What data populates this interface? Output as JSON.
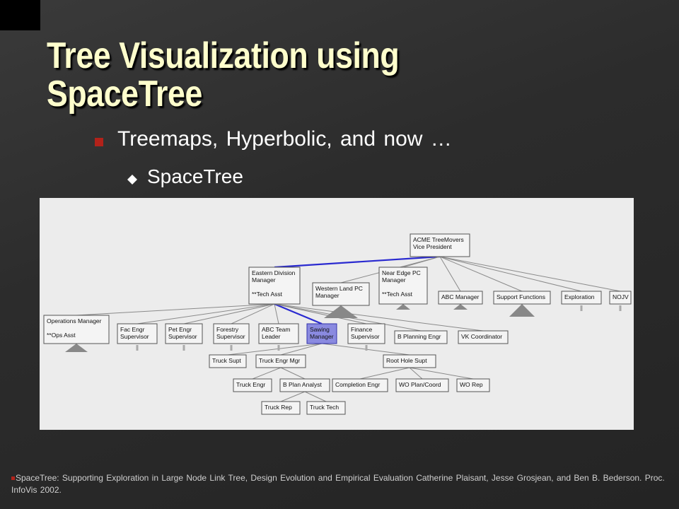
{
  "slide": {
    "title_line1": "Tree Visualization using",
    "title_line2": "SpaceTree",
    "bullet1": "Treemaps, Hyperbolic, and now …",
    "bullet2": "SpaceTree",
    "footnote": "SpaceTree: Supporting Exploration in Large Node Link Tree, Design Evolution and Empirical Evaluation Catherine Plaisant, Jesse Grosjean, and Ben B. Bederson. Proc. InfoVis 2002."
  },
  "colors": {
    "title": "#ffffcc",
    "bullet_marker": "#b2221a",
    "selected_node": "#8a8ae0",
    "selected_edge": "#2a2ad0"
  },
  "tree": {
    "root": [
      "ACME TreeMovers",
      "Vice President"
    ],
    "eastern": [
      "Eastern Division",
      "Manager",
      "",
      "**Tech Asst"
    ],
    "western": [
      "Western Land PC",
      "Manager"
    ],
    "near_edge": [
      "Near Edge PC",
      "Manager",
      "",
      "**Tech Asst"
    ],
    "abc_manager": [
      "ABC Manager"
    ],
    "support_functions": [
      "Support Functions"
    ],
    "exploration": [
      "Exploration"
    ],
    "nojv": [
      "NOJV"
    ],
    "operations": [
      "Operations Manager",
      "",
      "**Ops Asst"
    ],
    "fac_engr": [
      "Fac Engr",
      "Supervisor"
    ],
    "pet_engr": [
      "Pet Engr",
      "Supervisor"
    ],
    "forestry": [
      "Forestry",
      "Supervisor"
    ],
    "abc_team": [
      "ABC Team",
      "Leader"
    ],
    "sawing": [
      "Sawing",
      "Manager"
    ],
    "finance": [
      "Finance",
      "Supervisor"
    ],
    "b_planning": [
      "B Planning Engr"
    ],
    "vk_coord": [
      "VK Coordinator"
    ],
    "truck_supt": [
      "Truck Supt"
    ],
    "truck_engr_mgr": [
      "Truck Engr Mgr"
    ],
    "root_hole": [
      "Root Hole Supt"
    ],
    "truck_engr": [
      "Truck Engr"
    ],
    "b_plan_analyst": [
      "B Plan Analyst"
    ],
    "completion_engr": [
      "Completion Engr"
    ],
    "wo_plan": [
      "WO Plan/Coord"
    ],
    "wo_rep": [
      "WO Rep"
    ],
    "truck_rep": [
      "Truck Rep"
    ],
    "truck_tech": [
      "Truck Tech"
    ]
  }
}
